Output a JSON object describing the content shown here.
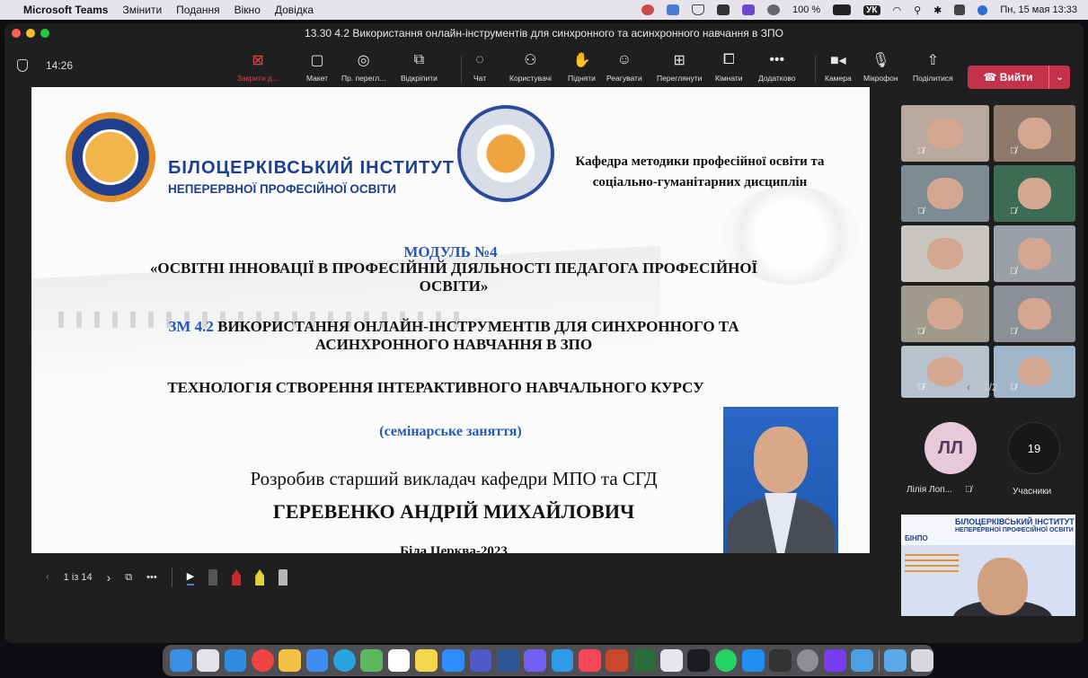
{
  "menubar": {
    "app_name": "Microsoft Teams",
    "items": [
      "Змінити",
      "Подання",
      "Вікно",
      "Довідка"
    ],
    "battery": "100 %",
    "keyboard": "УК",
    "datetime": "Пн, 15 мая 13:33"
  },
  "window": {
    "title": "13.30 4.2 Використання онлайн-інструментів для синхронного та асинхронного навчання в ЗПО"
  },
  "meeting": {
    "timer": "14:26",
    "toolbar": {
      "close": "Закрити д...",
      "layout": "Макет",
      "presenter_view": "Пр. перегл...",
      "popout": "Відкріпити",
      "chat": "Чат",
      "people": "Користувачі",
      "raise": "Підняти",
      "react": "Реагувати",
      "view": "Переглянути",
      "rooms": "Кімнати",
      "more": "Додатково",
      "camera": "Камера",
      "mic": "Мікрофон",
      "share": "Поділитися",
      "leave": "Вийти"
    }
  },
  "slide": {
    "institute_line1": "БІЛОЦЕРКІВСЬКИЙ ІНСТИТУТ",
    "institute_line2": "НЕПЕРЕРВНОЇ ПРОФЕСІЙНОЇ ОСВІТИ",
    "department_line1": "Кафедра методики професійної освіти та",
    "department_line2": "соціально-гуманітарних дисциплін",
    "module": "МОДУЛЬ №4",
    "module_title": "«ОСВІТНІ ІННОВАЦІЇ В ПРОФЕСІЙНІЙ ДІЯЛЬНОСТІ ПЕДАГОГА ПРОФЕСІЙНОЇ ОСВІТИ»",
    "submodule_code": "ЗМ 4.2",
    "submodule_title": "ВИКОРИСТАННЯ ОНЛАЙН-ІНСТРУМЕНТІВ ДЛЯ СИНХРОННОГО ТА АСИНХРОННОГО НАВЧАННЯ В ЗПО",
    "topic": "ТЕХНОЛОГІЯ СТВОРЕННЯ ІНТЕРАКТИВНОГО НАВЧАЛЬНОГО КУРСУ",
    "session_type": "(семінарське заняття)",
    "author_role": "Розробив старший викладач кафедри МПО та СГД",
    "author_name": "ГЕРЕВЕНКО АНДРІЙ МИХАЙЛОВИЧ",
    "place_year": "Біла Церква-2023"
  },
  "slide_controls": {
    "page": "1 із 14"
  },
  "participants": {
    "pager": "1/2",
    "initials": "ЛЛ",
    "name": "Лілія Лоп...",
    "count": "19",
    "count_label": "Учасники"
  },
  "share_preview": {
    "line1": "БІЛОЦЕРКІВСЬКИЙ ІНСТИТУТ",
    "line2": "НЕПЕРЕРВНОЇ ПРОФЕСІЙНОЇ ОСВІТИ",
    "brand": "БІНПО"
  },
  "colors": {
    "leave": "#c4314b",
    "accent_blue": "#2758b8",
    "institute_blue": "#1c3f8f"
  }
}
